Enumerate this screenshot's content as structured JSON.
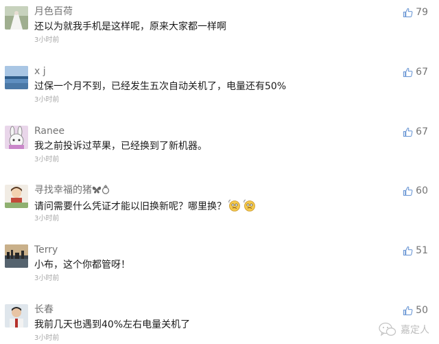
{
  "comments": [
    {
      "name": "月色百荷",
      "text": "还以为就我手机是这样呢，原来大家都一样啊",
      "time": "3小时前",
      "likes": "79",
      "avatar": "wedding-photo-avatar"
    },
    {
      "name": "x j",
      "text": "过保一个月不到，已经发生五次自动关机了，电量还有50%",
      "time": "3小时前",
      "likes": "67",
      "avatar": "sea-landscape-avatar"
    },
    {
      "name": "Ranee",
      "text": "我之前投诉过苹果，已经换到了新机器。",
      "time": "3小时前",
      "likes": "67",
      "avatar": "cartoon-bunny-avatar"
    },
    {
      "name": "寻找幸福的猪",
      "text": "请问需要什么凭证才能以旧换新呢？哪里换？",
      "time": "3小时前",
      "likes": "60",
      "avatar": "cartoon-figure-avatar"
    },
    {
      "name": "Terry",
      "text": "小布，这个你都管呀！",
      "time": "3小时前",
      "likes": "51",
      "avatar": "city-skyline-avatar"
    },
    {
      "name": "长春",
      "text": "我前几天也遇到40%左右电量关机了",
      "time": "3小时前",
      "likes": "50",
      "avatar": "person-photo-avatar"
    }
  ],
  "name_icons": [
    "butterfly-icon",
    "ring-icon"
  ],
  "text_emoji": [
    "confused-face-emoji",
    "confused-face-emoji"
  ],
  "icons": {
    "like": "thumbs-up-icon"
  },
  "watermark": {
    "text": "嘉定人",
    "icon": "wechat-logo-icon"
  },
  "colors": {
    "like_icon": "#6f9ad6",
    "name": "#737373",
    "time": "#a8a8a8",
    "text": "#1a1a1a"
  }
}
